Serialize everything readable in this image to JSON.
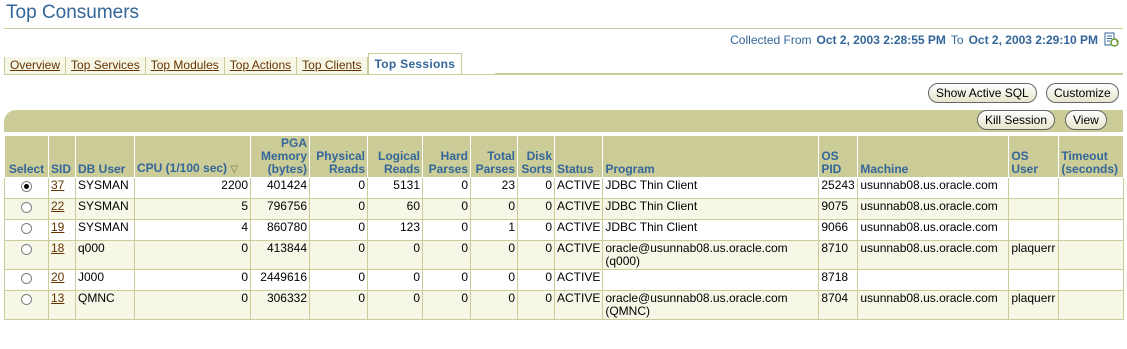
{
  "page": {
    "title": "Top Consumers"
  },
  "collected": {
    "prefix": "Collected From",
    "from": "Oct 2, 2003 2:28:55 PM",
    "to_word": "To",
    "to": "Oct 2, 2003 2:29:10 PM",
    "refresh_icon": "refresh-icon"
  },
  "tabs": [
    {
      "label": "Overview"
    },
    {
      "label": "Top Services"
    },
    {
      "label": "Top Modules"
    },
    {
      "label": "Top Actions"
    },
    {
      "label": "Top Clients"
    },
    {
      "label": "Top Sessions",
      "active": true
    }
  ],
  "buttons": {
    "show_active_sql": "Show Active SQL",
    "customize": "Customize",
    "kill_session": "Kill Session",
    "view": "View"
  },
  "table": {
    "headers": {
      "select": "Select",
      "sid": "SID",
      "db_user": "DB User",
      "cpu": "CPU (1/100 sec)",
      "pga_1": "PGA",
      "pga_2": "Memory",
      "pga_3": "(bytes)",
      "phys_1": "Physical",
      "phys_2": "Reads",
      "log_1": "Logical",
      "log_2": "Reads",
      "hard_1": "Hard",
      "hard_2": "Parses",
      "tot_1": "Total",
      "tot_2": "Parses",
      "disk_1": "Disk",
      "disk_2": "Sorts",
      "status": "Status",
      "program": "Program",
      "ospid_1": "OS",
      "ospid_2": "PID",
      "machine": "Machine",
      "osuser_1": "OS",
      "osuser_2": "User",
      "timeout_1": "Timeout",
      "timeout_2": "(seconds)"
    },
    "sort_indicator": "▽",
    "rows": [
      {
        "selected": true,
        "sid": "37",
        "db_user": "SYSMAN",
        "cpu": "2200",
        "pga": "401424",
        "phys": "0",
        "logical": "5131",
        "hard": "0",
        "total": "23",
        "disk": "0",
        "status": "ACTIVE",
        "program": "JDBC Thin Client",
        "program2": "",
        "os_pid": "25243",
        "machine": "usunnab08.us.oracle.com",
        "os_user": "",
        "timeout": ""
      },
      {
        "selected": false,
        "sid": "22",
        "db_user": "SYSMAN",
        "cpu": "5",
        "pga": "796756",
        "phys": "0",
        "logical": "60",
        "hard": "0",
        "total": "0",
        "disk": "0",
        "status": "ACTIVE",
        "program": "JDBC Thin Client",
        "program2": "",
        "os_pid": "9075",
        "machine": "usunnab08.us.oracle.com",
        "os_user": "",
        "timeout": ""
      },
      {
        "selected": false,
        "sid": "19",
        "db_user": "SYSMAN",
        "cpu": "4",
        "pga": "860780",
        "phys": "0",
        "logical": "123",
        "hard": "0",
        "total": "1",
        "disk": "0",
        "status": "ACTIVE",
        "program": "JDBC Thin Client",
        "program2": "",
        "os_pid": "9066",
        "machine": "usunnab08.us.oracle.com",
        "os_user": "",
        "timeout": ""
      },
      {
        "selected": false,
        "sid": "18",
        "db_user": "q000",
        "cpu": "0",
        "pga": "413844",
        "phys": "0",
        "logical": "0",
        "hard": "0",
        "total": "0",
        "disk": "0",
        "status": "ACTIVE",
        "program": "oracle@usunnab08.us.oracle.com",
        "program2": "(q000)",
        "os_pid": "8710",
        "machine": "usunnab08.us.oracle.com",
        "os_user": "plaquerr",
        "timeout": ""
      },
      {
        "selected": false,
        "sid": "20",
        "db_user": "J000",
        "cpu": "0",
        "pga": "2449616",
        "phys": "0",
        "logical": "0",
        "hard": "0",
        "total": "0",
        "disk": "0",
        "status": "ACTIVE",
        "program": "",
        "program2": "",
        "os_pid": "8718",
        "machine": "",
        "os_user": "",
        "timeout": ""
      },
      {
        "selected": false,
        "sid": "13",
        "db_user": "QMNC",
        "cpu": "0",
        "pga": "306332",
        "phys": "0",
        "logical": "0",
        "hard": "0",
        "total": "0",
        "disk": "0",
        "status": "ACTIVE",
        "program": "oracle@usunnab08.us.oracle.com",
        "program2": "(QMNC)",
        "os_pid": "8704",
        "machine": "usunnab08.us.oracle.com",
        "os_user": "plaquerr",
        "timeout": ""
      }
    ]
  }
}
